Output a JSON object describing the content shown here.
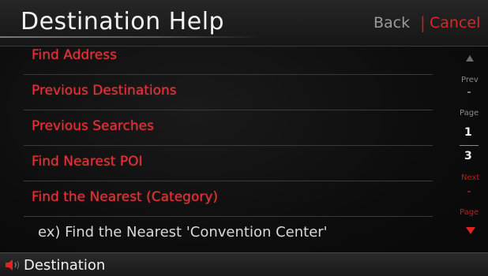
{
  "header": {
    "title": "Destination Help",
    "back_label": "Back",
    "separator": "|",
    "cancel_label": "Cancel"
  },
  "menu": {
    "items": [
      {
        "label": "Find Address"
      },
      {
        "label": "Previous Destinations"
      },
      {
        "label": "Previous Searches"
      },
      {
        "label": "Find Nearest POI"
      },
      {
        "label": "Find the Nearest (Category)"
      }
    ],
    "hint": "ex) Find the Nearest 'Convention Center'"
  },
  "pager": {
    "prev_label": "Prev",
    "page_label": "Page",
    "current_page": "1",
    "total_pages": "3",
    "next_label": "Next",
    "next_page_label": "Page"
  },
  "statusbar": {
    "icon": "speaker-icon",
    "label": "Destination"
  },
  "colors": {
    "accent_red": "#e02424",
    "background": "#0b0b0b",
    "text_light": "#f0f0f0"
  }
}
